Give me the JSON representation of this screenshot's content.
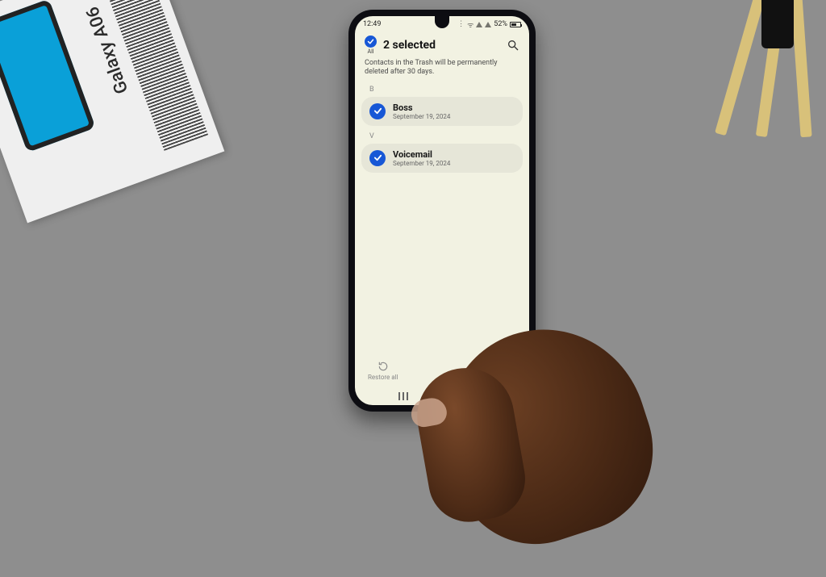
{
  "background": {
    "box_label": "Galaxy A06"
  },
  "status_bar": {
    "time": "12:49",
    "battery_text": "52%"
  },
  "header": {
    "all_label": "All",
    "title": "2 selected"
  },
  "info": {
    "text": "Contacts in the Trash will be permanently deleted after 30 days."
  },
  "sections": [
    {
      "letter": "B",
      "items": [
        {
          "name": "Boss",
          "date": "September 19, 2024",
          "selected": true
        }
      ]
    },
    {
      "letter": "V",
      "items": [
        {
          "name": "Voicemail",
          "date": "September 19, 2024",
          "selected": true
        }
      ]
    }
  ],
  "bottom": {
    "restore_label": "Restore all"
  }
}
